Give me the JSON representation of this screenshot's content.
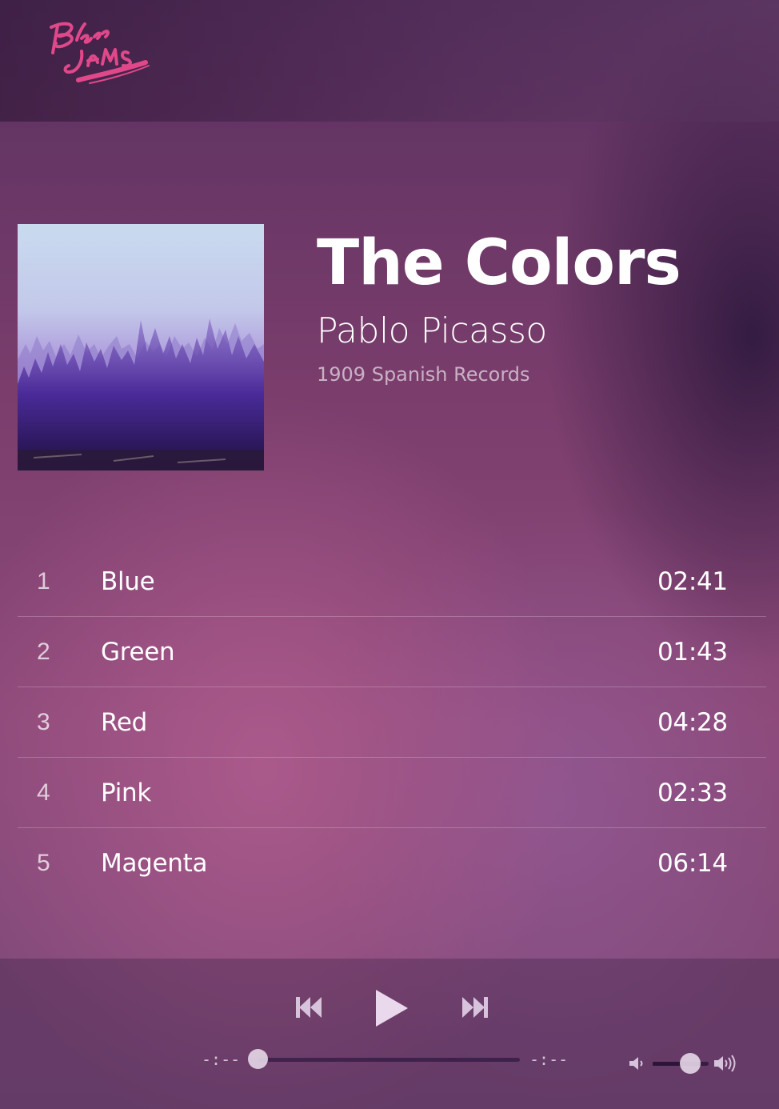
{
  "navbar": {
    "logo_text": "Bloc Jams"
  },
  "album": {
    "title": "The Colors",
    "artist": "Pablo Picasso",
    "release": "1909 Spanish Records"
  },
  "songs": [
    {
      "number": "1",
      "title": "Blue",
      "duration": "02:41"
    },
    {
      "number": "2",
      "title": "Green",
      "duration": "01:43"
    },
    {
      "number": "3",
      "title": "Red",
      "duration": "04:28"
    },
    {
      "number": "4",
      "title": "Pink",
      "duration": "02:33"
    },
    {
      "number": "5",
      "title": "Magenta",
      "duration": "06:14"
    }
  ],
  "player": {
    "current_time": "-:--",
    "total_time": "-:--",
    "seek_fraction": 0.0,
    "volume_fraction": 0.55,
    "icons": {
      "previous": "previous-track-icon",
      "play": "play-icon",
      "next": "next-track-icon",
      "volume_low": "volume-low-icon",
      "volume_high": "volume-high-icon"
    }
  },
  "colors": {
    "logo": "#e0488a",
    "text": "#ffffff",
    "secondary_text": "#d8bcd6"
  }
}
